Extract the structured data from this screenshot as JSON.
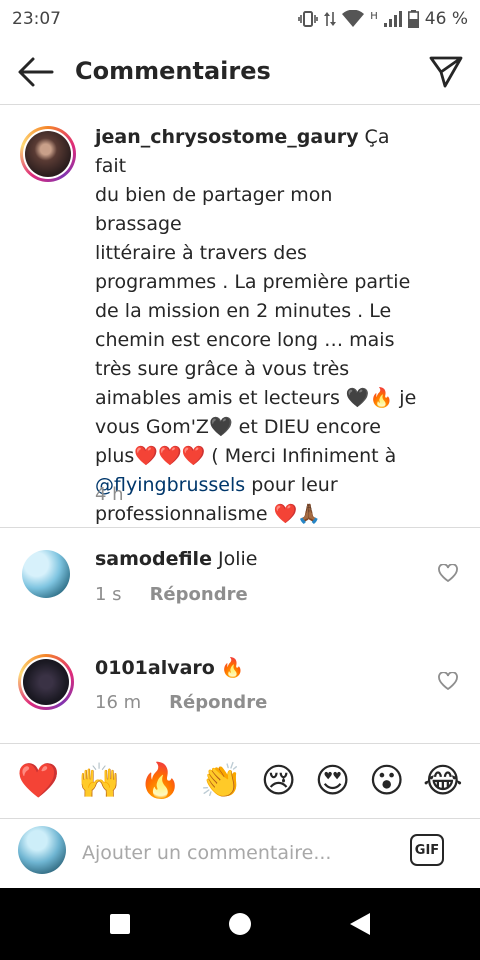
{
  "status_bar": {
    "time": "23:07",
    "network": "H",
    "battery": "46 %"
  },
  "header": {
    "title": "Commentaires",
    "back_icon": "arrow-left-icon",
    "send_icon": "paper-plane-icon"
  },
  "caption": {
    "username": "jean_chrysostome_gaury",
    "lines": [
      "Ça fait",
      "du bien de partager mon brassage",
      "littéraire à travers des",
      "programmes . La première partie",
      "de la mission en 2 minutes . Le",
      "chemin est encore long … mais",
      "très sure grâce à vous très",
      "aimables amis et lecteurs 🖤🔥 je",
      "vous Gom'Z🖤 et DIEU encore",
      "plus❤️❤️❤️ ( Merci Infiniment à"
    ],
    "mention": "@flyingbrussels",
    "after_mention": " pour leur",
    "last_line": "professionnalisme ❤️🙏🏾",
    "time": "4 h"
  },
  "comments": [
    {
      "username": "samodefile",
      "text": "Jolie",
      "time": "1 s",
      "reply_label": "Répondre"
    },
    {
      "username": "0101alvaro",
      "text": "🔥",
      "time": "16 m",
      "reply_label": "Répondre"
    }
  ],
  "emoji_bar": [
    "❤️",
    "🙌",
    "🔥",
    "👏",
    "😢",
    "😍",
    "😮",
    "😂"
  ],
  "input": {
    "placeholder": "Ajouter un commentaire...",
    "gif_label": "GIF"
  },
  "colors": {
    "text": "#262626",
    "secondary": "#8e8e8e",
    "mention": "#00376b",
    "divider": "#dbdbdb"
  }
}
